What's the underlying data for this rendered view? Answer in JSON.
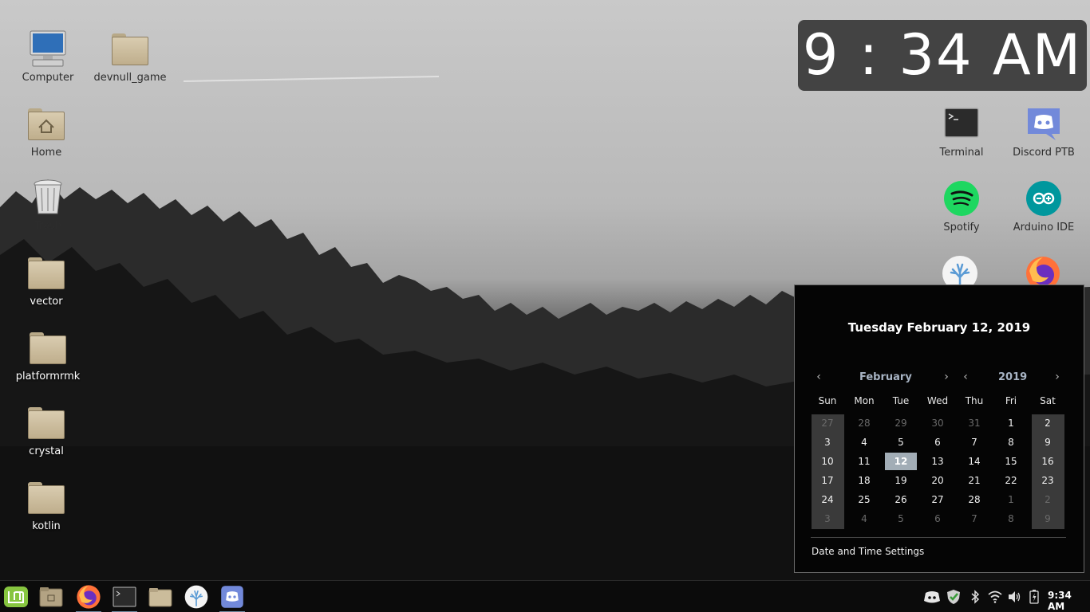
{
  "desktop": {
    "left_icons": [
      {
        "label": "Computer",
        "icon": "computer-icon"
      },
      {
        "label": "devnull_game",
        "icon": "folder-icon"
      },
      {
        "label": "Home",
        "icon": "home-folder-icon"
      },
      {
        "label": "Trash",
        "icon": "trash-icon"
      },
      {
        "label": "vector",
        "icon": "folder-icon"
      },
      {
        "label": "platformrmk",
        "icon": "folder-icon"
      },
      {
        "label": "crystal",
        "icon": "folder-icon"
      },
      {
        "label": "kotlin",
        "icon": "folder-icon"
      }
    ],
    "right_icons": [
      {
        "label": "Terminal",
        "icon": "terminal-icon"
      },
      {
        "label": "Discord PTB",
        "icon": "discord-icon"
      },
      {
        "label": "Spotify",
        "icon": "spotify-icon"
      },
      {
        "label": "Arduino IDE",
        "icon": "arduino-icon"
      }
    ]
  },
  "clock_widget": {
    "time": "9 : 34 AM"
  },
  "calendar": {
    "full_date": "Tuesday February 12, 2019",
    "month": "February",
    "year": "2019",
    "weekdays": [
      "Sun",
      "Mon",
      "Tue",
      "Wed",
      "Thu",
      "Fri",
      "Sat"
    ],
    "weeks": [
      [
        "27",
        "28",
        "29",
        "30",
        "31",
        "1",
        "2"
      ],
      [
        "3",
        "4",
        "5",
        "6",
        "7",
        "8",
        "9"
      ],
      [
        "10",
        "11",
        "12",
        "13",
        "14",
        "15",
        "16"
      ],
      [
        "17",
        "18",
        "19",
        "20",
        "21",
        "22",
        "23"
      ],
      [
        "24",
        "25",
        "26",
        "27",
        "28",
        "1",
        "2"
      ],
      [
        "3",
        "4",
        "5",
        "6",
        "7",
        "8",
        "9"
      ]
    ],
    "today": "12",
    "settings_link": "Date and Time Settings"
  },
  "taskbar": {
    "clock": "9:34 AM",
    "launchers": [
      "mint-menu-icon",
      "file-manager-icon",
      "firefox-icon",
      "terminal-icon",
      "folder-icon",
      "vector-icon",
      "discord-icon"
    ],
    "tray": [
      "discord-tray-icon",
      "shield-check-icon",
      "bluetooth-icon",
      "wifi-icon",
      "volume-icon",
      "battery-icon"
    ]
  },
  "colors": {
    "today_highlight": "#a2adb6",
    "weekend_column": "#3a3a3a",
    "nav_text": "#a8b4c4"
  }
}
